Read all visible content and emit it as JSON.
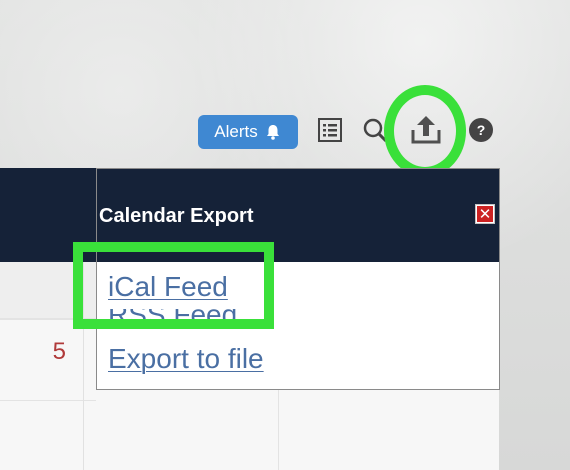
{
  "toolbar": {
    "alerts_label": "Alerts",
    "icons": [
      "bell-icon",
      "list-icon",
      "search-icon",
      "export-icon",
      "help-icon"
    ],
    "accent_color": "#3f88d2"
  },
  "calendar": {
    "day_number": "5",
    "header_color": "#152238"
  },
  "popup": {
    "title": "Calendar Export",
    "close_symbol": "✕",
    "links": {
      "ical": "iCal Feed",
      "rss": "RSS Feed",
      "export": "Export to file"
    },
    "link_color": "#4a6fa3"
  },
  "annotations": {
    "highlight_color": "#3ae03a"
  }
}
